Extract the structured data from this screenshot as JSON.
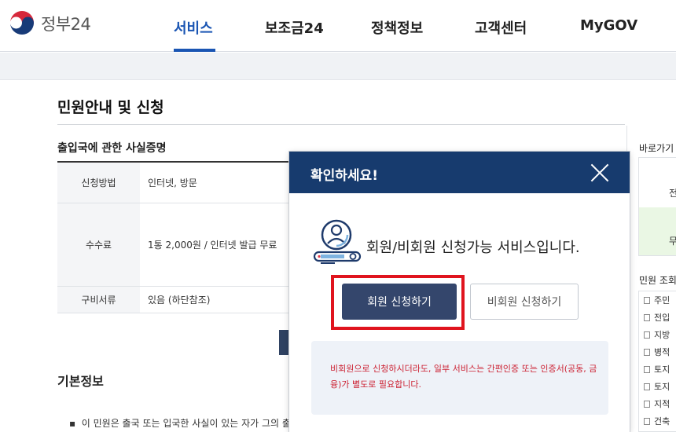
{
  "header": {
    "logo_text": "정부24",
    "nav": [
      {
        "label": "서비스",
        "active": true
      },
      {
        "label": "보조금24",
        "active": false
      },
      {
        "label": "정책정보",
        "active": false
      },
      {
        "label": "고객센터",
        "active": false
      },
      {
        "label": "MyGOV",
        "active": false
      }
    ]
  },
  "main": {
    "page_title": "민원안내 및 신청",
    "section_title": "출입국에 관한 사실증명",
    "table": [
      {
        "label": "신청방법",
        "value": "인터넷, 방문"
      },
      {
        "label": "수수료",
        "value": "1통 2,000원 / 인터넷 발급 무료"
      },
      {
        "label": "구비서류",
        "value": "있음 (하단참조)"
      }
    ],
    "basic_info_title": "기본정보",
    "bullet_text": "이 민원은 출국 또는 입국한 사실이 있는 자가 그의 출입"
  },
  "sidebar": {
    "shortcut_label": "바로가기",
    "shortcut_chars": [
      "전",
      "무"
    ],
    "lookup_label": "민원 조회",
    "list": [
      "주민",
      "전입",
      "지방",
      "병적",
      "토지",
      "토지",
      "지적",
      "건축"
    ]
  },
  "modal": {
    "title": "확인하세요!",
    "message": "회원/비회원 신청가능 서비스입니다.",
    "member_button": "회원 신청하기",
    "guest_button": "비회원 신청하기",
    "notice": "비회원으로 신청하시더라도, 일부 서비스는 간편인증 또는 인증서(공동, 금융)가 별도로 필요합니다."
  },
  "colors": {
    "brand_blue": "#1a55b3",
    "modal_header": "#173b6e",
    "member_button": "#34466c",
    "highlight_red": "#e0141e",
    "notice_red": "#cc2233"
  }
}
